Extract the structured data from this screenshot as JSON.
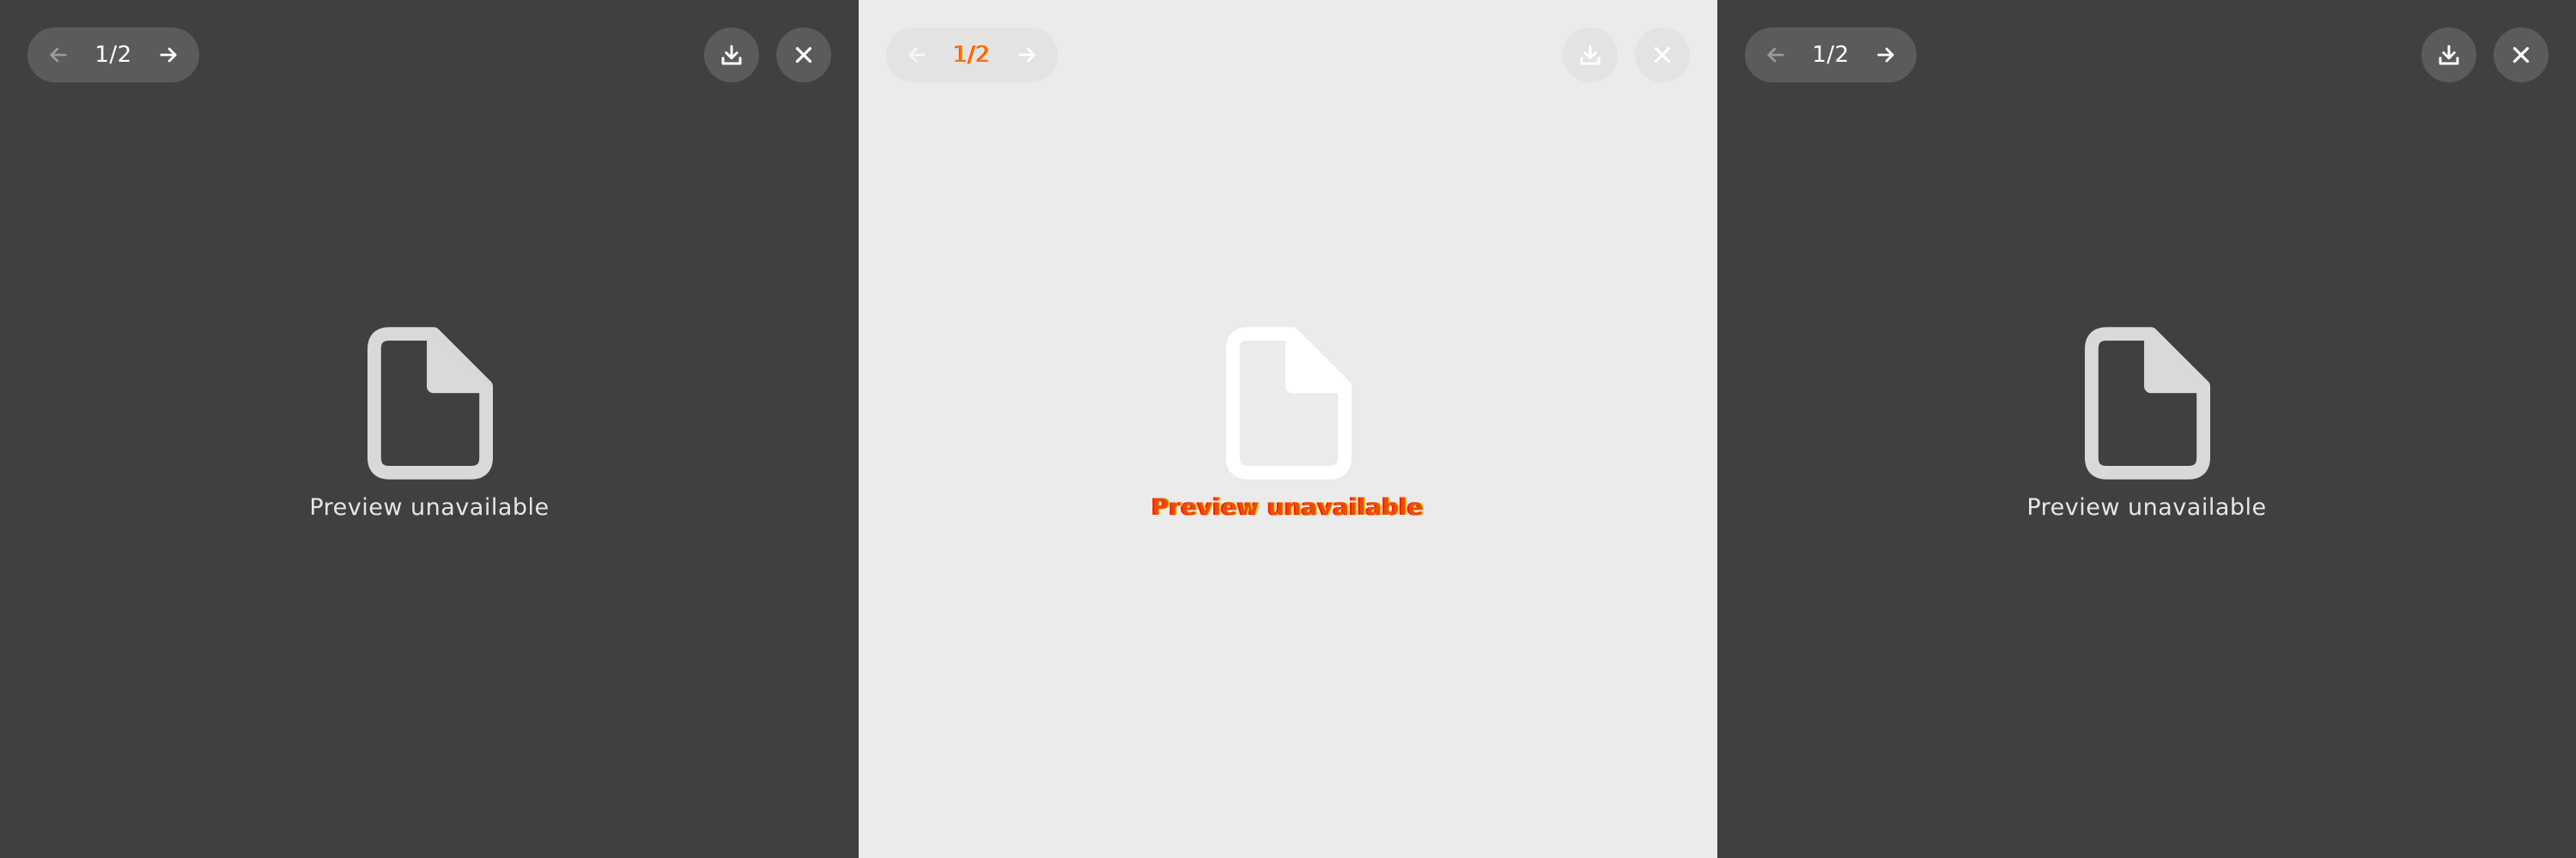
{
  "colors": {
    "dark_background": "#404040",
    "light_background": "#ebebeb",
    "dark_control": "#5b5b5b",
    "light_control": "#e3e3e3",
    "dark_icon": "#d9d9d9",
    "light_icon": "#ffffff"
  },
  "panels": [
    {
      "theme": "dark",
      "pager": {
        "count": "1/2",
        "prev_icon": "arrow-left-icon",
        "next_icon": "arrow-right-icon"
      },
      "actions": {
        "download_icon": "download-icon",
        "close_icon": "close-icon"
      },
      "placeholder": {
        "icon": "file-icon",
        "text": "Preview unavailable"
      }
    },
    {
      "theme": "light",
      "pager": {
        "count": "1/2",
        "prev_icon": "arrow-left-icon",
        "next_icon": "arrow-right-icon"
      },
      "actions": {
        "download_icon": "download-icon",
        "close_icon": "close-icon"
      },
      "placeholder": {
        "icon": "file-icon",
        "text": "Preview unavailable"
      }
    },
    {
      "theme": "dark",
      "pager": {
        "count": "1/2",
        "prev_icon": "arrow-left-icon",
        "next_icon": "arrow-right-icon"
      },
      "actions": {
        "download_icon": "download-icon",
        "close_icon": "close-icon"
      },
      "placeholder": {
        "icon": "file-icon",
        "text": "Preview unavailable"
      }
    }
  ]
}
